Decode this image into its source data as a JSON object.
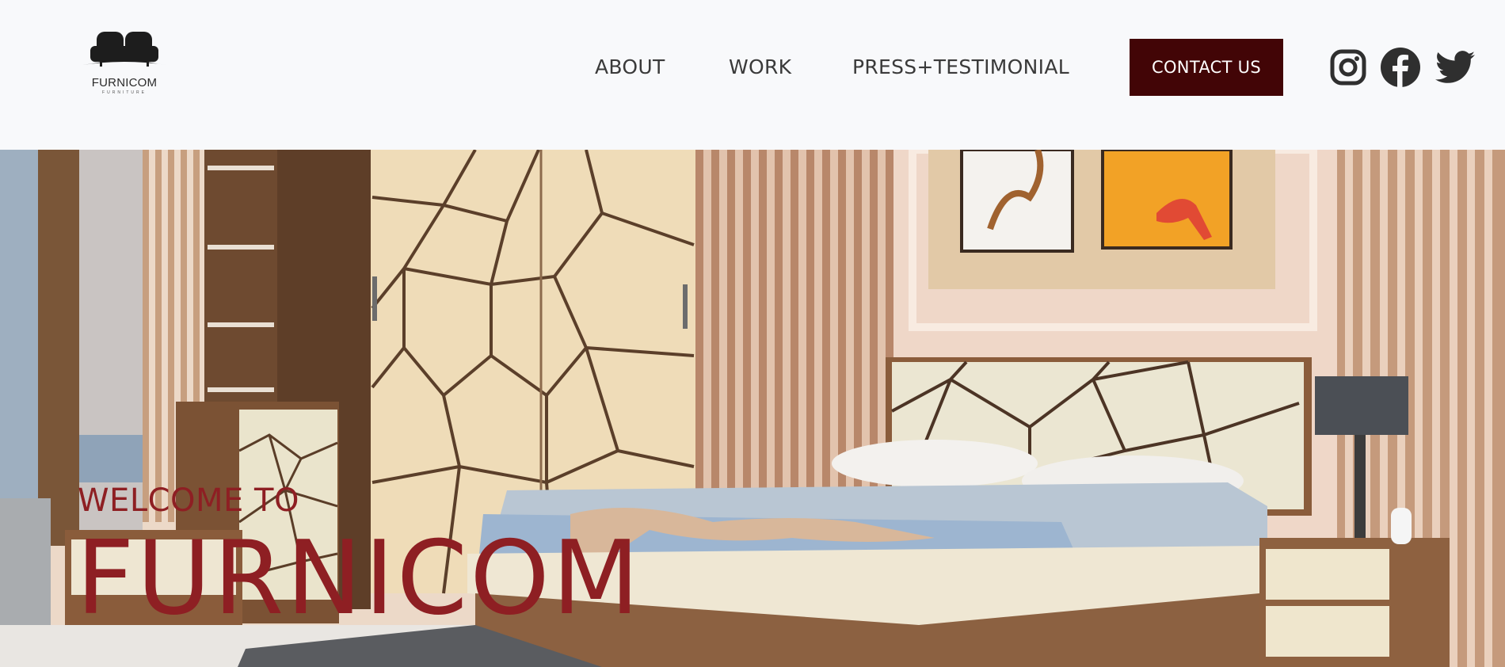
{
  "header": {
    "logo": {
      "name": "FURNICOM",
      "tagline": "FURNITURE",
      "icon": "sofa-icon"
    },
    "nav": [
      {
        "label": "ABOUT"
      },
      {
        "label": "WORK"
      },
      {
        "label": "PRESS+TESTIMONIAL"
      }
    ],
    "contact_label": "CONTACT US",
    "social": [
      {
        "icon": "instagram-icon"
      },
      {
        "icon": "facebook-icon"
      },
      {
        "icon": "twitter-icon"
      }
    ]
  },
  "hero": {
    "welcome": "WELCOME TO",
    "brand": "FURNICOM",
    "image": "bedroom-photo"
  },
  "colors": {
    "header_bg": "#f8f9fb",
    "accent": "#420506",
    "hero_text": "#8e1f23",
    "nav_text": "#3a3a3a",
    "icon": "#2f2f2f"
  }
}
